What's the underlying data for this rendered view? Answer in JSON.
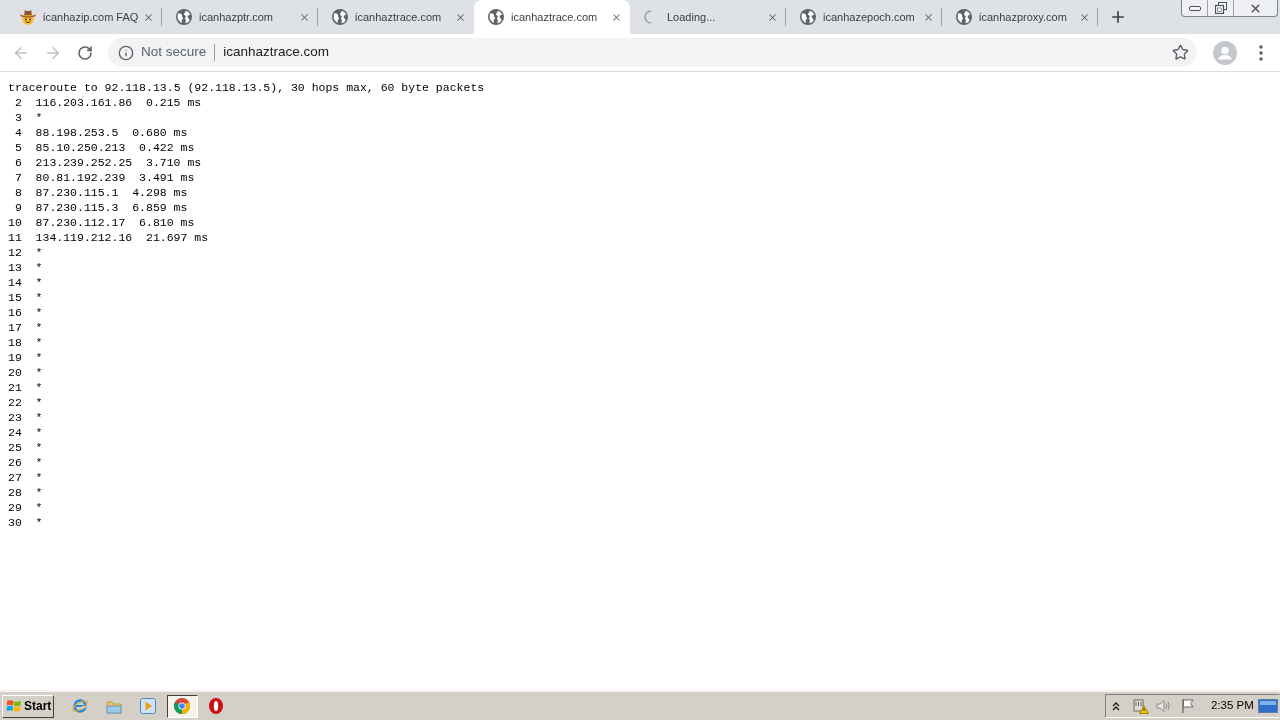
{
  "tabs": [
    {
      "title": "icanhazip.com FAQ",
      "kind": "emoji",
      "selected": false
    },
    {
      "title": "icanhazptr.com",
      "kind": "globe",
      "selected": false
    },
    {
      "title": "icanhaztrace.com",
      "kind": "globe",
      "selected": false
    },
    {
      "title": "icanhaztrace.com",
      "kind": "globe",
      "selected": true
    },
    {
      "title": "Loading...",
      "kind": "loading",
      "selected": false
    },
    {
      "title": "icanhazepoch.com",
      "kind": "globe",
      "selected": false
    },
    {
      "title": "icanhazproxy.com",
      "kind": "globe",
      "selected": false
    }
  ],
  "toolbar": {
    "navigation": [
      {
        "kind": "back",
        "disabled": true
      },
      {
        "kind": "forward",
        "disabled": true
      },
      {
        "kind": "reload",
        "disabled": false
      }
    ],
    "address_bar": {
      "security": "Not secure",
      "url": "icanhaztrace.com"
    }
  },
  "page": {
    "header": "traceroute to 92.118.13.5 (92.118.13.5), 30 hops max, 60 byte packets",
    "hops": [
      {
        "hop": "2",
        "reply": "116.203.161.86  0.215 ms"
      },
      {
        "hop": "3",
        "reply": "*"
      },
      {
        "hop": "4",
        "reply": "88.198.253.5  0.680 ms"
      },
      {
        "hop": "5",
        "reply": "85.10.250.213  0.422 ms"
      },
      {
        "hop": "6",
        "reply": "213.239.252.25  3.710 ms"
      },
      {
        "hop": "7",
        "reply": "80.81.192.239  3.491 ms"
      },
      {
        "hop": "8",
        "reply": "87.230.115.1  4.298 ms"
      },
      {
        "hop": "9",
        "reply": "87.230.115.3  6.859 ms"
      },
      {
        "hop": "10",
        "reply": "87.230.112.17  6.810 ms"
      },
      {
        "hop": "11",
        "reply": "134.119.212.16  21.697 ms"
      },
      {
        "hop": "12",
        "reply": "*"
      },
      {
        "hop": "13",
        "reply": "*"
      },
      {
        "hop": "14",
        "reply": "*"
      },
      {
        "hop": "15",
        "reply": "*"
      },
      {
        "hop": "16",
        "reply": "*"
      },
      {
        "hop": "17",
        "reply": "*"
      },
      {
        "hop": "18",
        "reply": "*"
      },
      {
        "hop": "19",
        "reply": "*"
      },
      {
        "hop": "20",
        "reply": "*"
      },
      {
        "hop": "21",
        "reply": "*"
      },
      {
        "hop": "22",
        "reply": "*"
      },
      {
        "hop": "23",
        "reply": "*"
      },
      {
        "hop": "24",
        "reply": "*"
      },
      {
        "hop": "25",
        "reply": "*"
      },
      {
        "hop": "26",
        "reply": "*"
      },
      {
        "hop": "27",
        "reply": "*"
      },
      {
        "hop": "28",
        "reply": "*"
      },
      {
        "hop": "29",
        "reply": "*"
      },
      {
        "hop": "30",
        "reply": "*"
      }
    ]
  },
  "taskbar": {
    "start": "Start",
    "apps": [
      {
        "kind": "explorer",
        "selected": false
      },
      {
        "kind": "folder",
        "selected": false
      },
      {
        "kind": "player",
        "selected": false
      },
      {
        "kind": "browser",
        "selected": true
      },
      {
        "kind": "ring",
        "selected": false
      }
    ],
    "clock": "2:35 PM"
  }
}
